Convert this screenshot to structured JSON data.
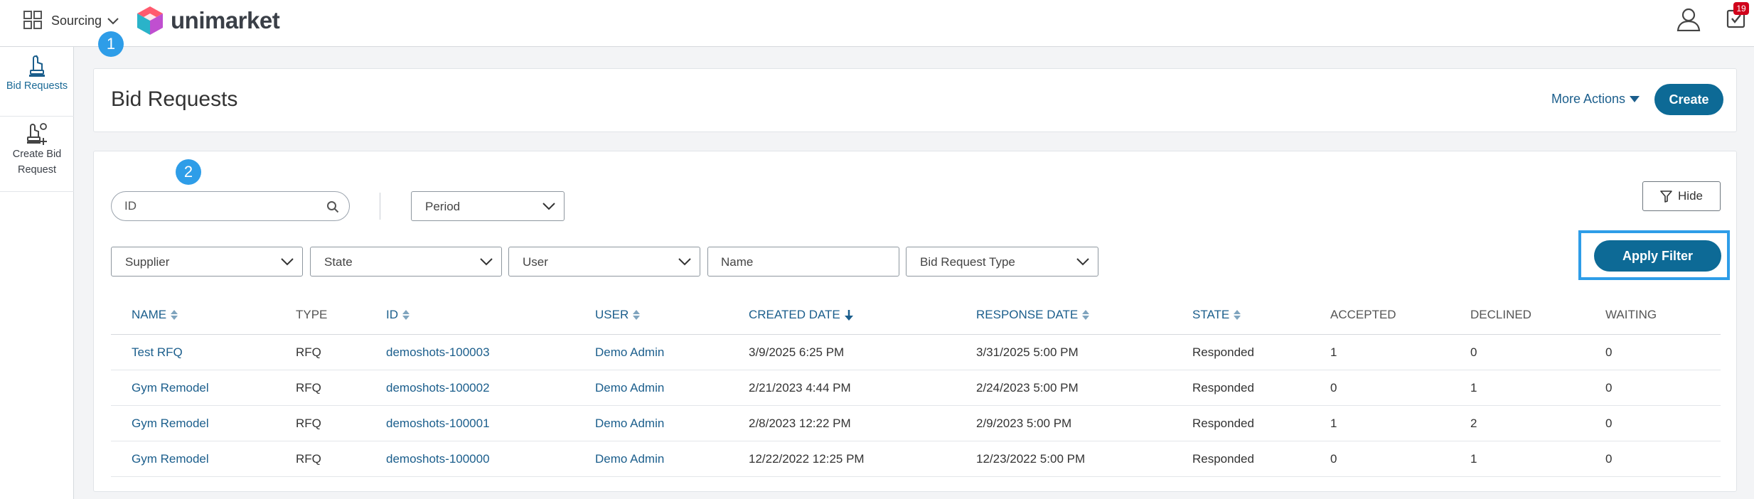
{
  "topbar": {
    "module": "Sourcing",
    "logo_text": "unimarket",
    "tasks_count": "19",
    "icons": [
      "apps-grid-icon",
      "chevron-down-icon",
      "user-icon",
      "tasks-icon"
    ],
    "step_markers": [
      "1",
      "2"
    ]
  },
  "sidebar": {
    "items": [
      {
        "label": "Bid Requests",
        "icon": "bid-requests-icon",
        "active": true
      },
      {
        "label": "Create Bid Request",
        "icon": "create-bid-request-icon",
        "active": false
      }
    ]
  },
  "header": {
    "title": "Bid Requests",
    "more_actions": "More Actions",
    "create": "Create"
  },
  "filters": {
    "id_placeholder": "ID",
    "period": "Period",
    "supplier": "Supplier",
    "state": "State",
    "user": "User",
    "name_placeholder": "Name",
    "bid_request_type": "Bid Request Type",
    "hide": "Hide",
    "apply": "Apply Filter"
  },
  "table": {
    "columns": [
      "NAME",
      "TYPE",
      "ID",
      "USER",
      "CREATED DATE",
      "RESPONSE DATE",
      "STATE",
      "ACCEPTED",
      "DECLINED",
      "WAITING"
    ],
    "rows": [
      [
        "Test RFQ",
        "RFQ",
        "demoshots-100003",
        "Demo Admin",
        "3/9/2025 6:25 PM",
        "3/31/2025 5:00 PM",
        "Responded",
        "1",
        "0",
        "0"
      ],
      [
        "Gym Remodel",
        "RFQ",
        "demoshots-100002",
        "Demo Admin",
        "2/21/2023 4:44 PM",
        "2/24/2023 5:00 PM",
        "Responded",
        "0",
        "1",
        "0"
      ],
      [
        "Gym Remodel",
        "RFQ",
        "demoshots-100001",
        "Demo Admin",
        "2/8/2023 12:22 PM",
        "2/9/2023 5:00 PM",
        "Responded",
        "1",
        "2",
        "0"
      ],
      [
        "Gym Remodel",
        "RFQ",
        "demoshots-100000",
        "Demo Admin",
        "12/22/2022 12:25 PM",
        "12/23/2022 5:00 PM",
        "Responded",
        "0",
        "1",
        "0"
      ]
    ]
  },
  "colors": {
    "primary": "#0d6a96",
    "link": "#1b5e8c",
    "marker": "#2e9de8",
    "badge": "#d0021b"
  }
}
